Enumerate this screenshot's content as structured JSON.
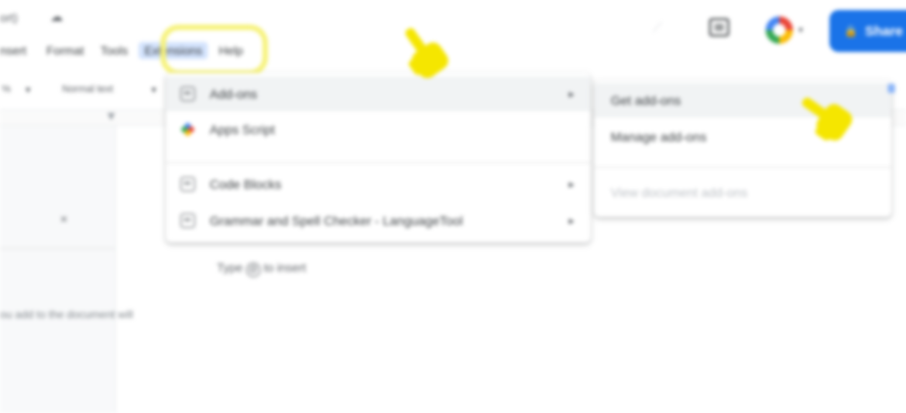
{
  "window": {
    "title_fragment": "ort)",
    "title_icon": "cloud-icon"
  },
  "menubar": {
    "items": [
      {
        "label": "nsert"
      },
      {
        "label": "Format"
      },
      {
        "label": "Tools"
      },
      {
        "label": "Extensions",
        "active": true
      },
      {
        "label": "Help"
      }
    ]
  },
  "header": {
    "share_label": "Share",
    "share_icon": "lock-icon",
    "accent": "#1a73e8"
  },
  "toolbar": {
    "zoom_fragment": "%",
    "font": "Normal text",
    "style_caret": "▾"
  },
  "outline": {
    "close_glyph": "×",
    "hint": "ou add to the document will"
  },
  "doc": {
    "hint_prefix": "Type",
    "hint_suffix": "to insert"
  },
  "extensions_menu": {
    "items": [
      {
        "label": "Add-ons",
        "icon": "addons-icon",
        "has_submenu": true,
        "hovered": true
      },
      {
        "label": "Apps Script",
        "icon": "apps-script-icon",
        "has_submenu": false
      },
      {
        "label": "Code Blocks",
        "icon": "addon-icon",
        "has_submenu": true
      },
      {
        "label": "Grammar and Spell Checker - LanguageTool",
        "icon": "addon-icon",
        "has_submenu": true
      }
    ]
  },
  "addons_submenu": {
    "items": [
      {
        "label": "Get add-ons",
        "hovered": true
      },
      {
        "label": "Manage add-ons"
      },
      {
        "label": "View document add-ons",
        "disabled": true
      }
    ]
  },
  "annotation": {
    "highlight_color": "#f6f27a",
    "hand_color": "#f5e600"
  }
}
